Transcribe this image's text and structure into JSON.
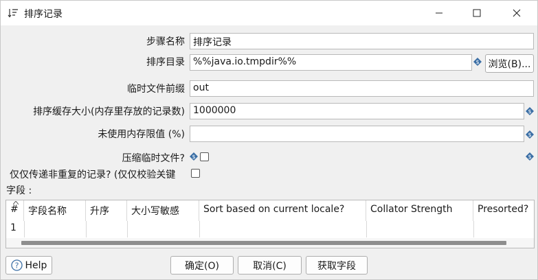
{
  "window": {
    "title": "排序记录",
    "icons": {
      "app": "sort-icon",
      "minimize": "minimize-icon",
      "maximize": "maximize-icon",
      "close": "close-icon"
    }
  },
  "form": {
    "step_name": {
      "label": "步骤名称",
      "value": "排序记录"
    },
    "sort_dir": {
      "label": "排序目录",
      "value": "%%java.io.tmpdir%%",
      "browse": "浏览(B)..."
    },
    "temp_prefix": {
      "label": "临时文件前缀",
      "value": "out"
    },
    "sort_size": {
      "label": "排序缓存大小(内存里存放的记录数)",
      "value": "1000000"
    },
    "free_memory": {
      "label": "未使用内存限值 (%)",
      "value": ""
    },
    "compress": {
      "label": "压缩临时文件?"
    },
    "unique": {
      "label": "仅仅传递非重复的记录? (仅仅校验关键"
    }
  },
  "fields": {
    "label": "字段 :",
    "columns": [
      "#",
      "字段名称",
      "升序",
      "大小写敏感",
      "Sort based on current locale?",
      "Collator Strength",
      "Presorted?"
    ],
    "rows": [
      [
        "1",
        "",
        "",
        "",
        "",
        "",
        ""
      ]
    ]
  },
  "footer": {
    "help": "Help",
    "ok": "确定(O)",
    "cancel": "取消(C)",
    "get_fields": "获取字段"
  },
  "colors": {
    "variable_icon": "#3a6ea5",
    "help_icon": "#3a6ea5",
    "scroll_thumb": "#8e8e8e"
  }
}
